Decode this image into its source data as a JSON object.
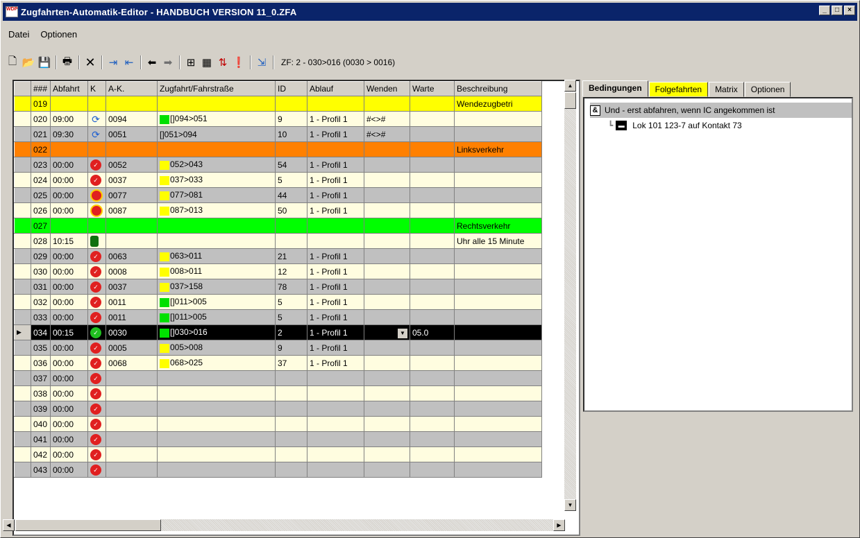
{
  "window": {
    "title": "Zugfahrten-Automatik-Editor - HANDBUCH VERSION 11_0.ZFA",
    "icon_text": "WDP"
  },
  "menu": [
    {
      "label": "Datei"
    },
    {
      "label": "Optionen"
    }
  ],
  "toolbar": {
    "status": "ZF: 2 - 030>016 (0030 > 0016)",
    "icons": [
      "new-file-icon",
      "open-folder-icon",
      "save-icon",
      "print-icon",
      "delete-icon",
      "indent-icon",
      "outdent-icon",
      "arrow-left-icon",
      "arrow-right-icon",
      "tree-icon",
      "grid-icon",
      "swap-icon",
      "warning-icon",
      "exit-icon"
    ]
  },
  "columns": [
    "###",
    "Abfahrt",
    "K",
    "A-K.",
    "Zugfahrt/Fahrstraße",
    "ID",
    "Ablauf",
    "Wenden",
    "Warte",
    "Beschreibung"
  ],
  "rows": [
    {
      "nr": "019",
      "abfahrt": "",
      "k": "",
      "ak": "",
      "zug": "",
      "id": "",
      "ablauf": "",
      "wenden": "",
      "warte": "",
      "desc": "Wendezugbetri",
      "style": "yellow",
      "kicon": "",
      "swatch": ""
    },
    {
      "nr": "020",
      "abfahrt": "09:00",
      "k": "",
      "ak": "0094",
      "zug": "[]094>051",
      "id": "9",
      "ablauf": "1 - Profil 1",
      "wenden": "#<>#",
      "warte": "",
      "desc": "",
      "style": "cream",
      "kicon": "turn",
      "swatch": "#00e000"
    },
    {
      "nr": "021",
      "abfahrt": "09:30",
      "k": "",
      "ak": "0051",
      "zug": "[]051>094",
      "id": "10",
      "ablauf": "1 - Profil 1",
      "wenden": "#<>#",
      "warte": "",
      "desc": "",
      "style": "grey",
      "kicon": "turn",
      "swatch": ""
    },
    {
      "nr": "022",
      "abfahrt": "",
      "k": "",
      "ak": "",
      "zug": "",
      "id": "",
      "ablauf": "",
      "wenden": "",
      "warte": "",
      "desc": "Linksverkehr",
      "style": "orange",
      "kicon": "",
      "swatch": ""
    },
    {
      "nr": "023",
      "abfahrt": "00:00",
      "k": "",
      "ak": "0052",
      "zug": "052>043",
      "id": "54",
      "ablauf": "1 - Profil 1",
      "wenden": "",
      "warte": "",
      "desc": "",
      "style": "grey",
      "kicon": "red",
      "swatch": "#ffff00"
    },
    {
      "nr": "024",
      "abfahrt": "00:00",
      "k": "",
      "ak": "0037",
      "zug": "037>033",
      "id": "5",
      "ablauf": "1 - Profil 1",
      "wenden": "",
      "warte": "",
      "desc": "",
      "style": "cream",
      "kicon": "red",
      "swatch": "#ffff00"
    },
    {
      "nr": "025",
      "abfahrt": "00:00",
      "k": "",
      "ak": "0077",
      "zug": "077>081",
      "id": "44",
      "ablauf": "1 - Profil 1",
      "wenden": "",
      "warte": "",
      "desc": "",
      "style": "grey",
      "kicon": "redring",
      "swatch": "#ffff00"
    },
    {
      "nr": "026",
      "abfahrt": "00:00",
      "k": "",
      "ak": "0087",
      "zug": "087>013",
      "id": "50",
      "ablauf": "1 - Profil 1",
      "wenden": "",
      "warte": "",
      "desc": "",
      "style": "cream",
      "kicon": "redring",
      "swatch": "#ffff00"
    },
    {
      "nr": "027",
      "abfahrt": "",
      "k": "",
      "ak": "",
      "zug": "",
      "id": "",
      "ablauf": "",
      "wenden": "",
      "warte": "",
      "desc": "Rechtsverkehr",
      "style": "green",
      "kicon": "",
      "swatch": ""
    },
    {
      "nr": "028",
      "abfahrt": "10:15",
      "k": "",
      "ak": "",
      "zug": "",
      "id": "",
      "ablauf": "",
      "wenden": "",
      "warte": "",
      "desc": "Uhr alle 15 Minute",
      "style": "cream",
      "kicon": "signal",
      "swatch": "",
      "plain": true
    },
    {
      "nr": "029",
      "abfahrt": "00:00",
      "k": "",
      "ak": "0063",
      "zug": "063>011",
      "id": "21",
      "ablauf": "1 - Profil 1",
      "wenden": "",
      "warte": "",
      "desc": "",
      "style": "grey",
      "kicon": "red",
      "swatch": "#ffff00"
    },
    {
      "nr": "030",
      "abfahrt": "00:00",
      "k": "",
      "ak": "0008",
      "zug": "008>011",
      "id": "12",
      "ablauf": "1 - Profil 1",
      "wenden": "",
      "warte": "",
      "desc": "",
      "style": "cream",
      "kicon": "red",
      "swatch": "#ffff00"
    },
    {
      "nr": "031",
      "abfahrt": "00:00",
      "k": "",
      "ak": "0037",
      "zug": "037>158",
      "id": "78",
      "ablauf": "1 - Profil 1",
      "wenden": "",
      "warte": "",
      "desc": "",
      "style": "grey",
      "kicon": "red",
      "swatch": "#ffff00"
    },
    {
      "nr": "032",
      "abfahrt": "00:00",
      "k": "",
      "ak": "0011",
      "zug": "[]011>005",
      "id": "5",
      "ablauf": "1 - Profil 1",
      "wenden": "",
      "warte": "",
      "desc": "",
      "style": "cream",
      "kicon": "red",
      "swatch": "#00e000"
    },
    {
      "nr": "033",
      "abfahrt": "00:00",
      "k": "",
      "ak": "0011",
      "zug": "[]011>005",
      "id": "5",
      "ablauf": "1 - Profil 1",
      "wenden": "",
      "warte": "",
      "desc": "",
      "style": "grey",
      "kicon": "red",
      "swatch": "#00e000"
    },
    {
      "nr": "034",
      "abfahrt": "00:15",
      "k": "",
      "ak": "0030",
      "zug": "[]030>016",
      "id": "2",
      "ablauf": "1 - Profil 1",
      "wenden": "",
      "warte": "05.0",
      "desc": "",
      "style": "sel",
      "kicon": "green",
      "swatch": "#00e000",
      "current": true
    },
    {
      "nr": "035",
      "abfahrt": "00:00",
      "k": "",
      "ak": "0005",
      "zug": "005>008",
      "id": "9",
      "ablauf": "1 - Profil 1",
      "wenden": "",
      "warte": "",
      "desc": "",
      "style": "grey",
      "kicon": "red",
      "swatch": "#ffff00"
    },
    {
      "nr": "036",
      "abfahrt": "00:00",
      "k": "",
      "ak": "0068",
      "zug": "068>025",
      "id": "37",
      "ablauf": "1 - Profil 1",
      "wenden": "",
      "warte": "",
      "desc": "",
      "style": "cream",
      "kicon": "red",
      "swatch": "#ffff00"
    },
    {
      "nr": "037",
      "abfahrt": "00:00",
      "k": "",
      "ak": "",
      "zug": "",
      "id": "",
      "ablauf": "",
      "wenden": "",
      "warte": "",
      "desc": "",
      "style": "grey",
      "kicon": "red",
      "swatch": ""
    },
    {
      "nr": "038",
      "abfahrt": "00:00",
      "k": "",
      "ak": "",
      "zug": "",
      "id": "",
      "ablauf": "",
      "wenden": "",
      "warte": "",
      "desc": "",
      "style": "cream",
      "kicon": "red",
      "swatch": ""
    },
    {
      "nr": "039",
      "abfahrt": "00:00",
      "k": "",
      "ak": "",
      "zug": "",
      "id": "",
      "ablauf": "",
      "wenden": "",
      "warte": "",
      "desc": "",
      "style": "grey",
      "kicon": "red",
      "swatch": ""
    },
    {
      "nr": "040",
      "abfahrt": "00:00",
      "k": "",
      "ak": "",
      "zug": "",
      "id": "",
      "ablauf": "",
      "wenden": "",
      "warte": "",
      "desc": "",
      "style": "cream",
      "kicon": "red",
      "swatch": ""
    },
    {
      "nr": "041",
      "abfahrt": "00:00",
      "k": "",
      "ak": "",
      "zug": "",
      "id": "",
      "ablauf": "",
      "wenden": "",
      "warte": "",
      "desc": "",
      "style": "grey",
      "kicon": "red",
      "swatch": ""
    },
    {
      "nr": "042",
      "abfahrt": "00:00",
      "k": "",
      "ak": "",
      "zug": "",
      "id": "",
      "ablauf": "",
      "wenden": "",
      "warte": "",
      "desc": "",
      "style": "cream",
      "kicon": "red",
      "swatch": ""
    },
    {
      "nr": "043",
      "abfahrt": "00:00",
      "k": "",
      "ak": "",
      "zug": "",
      "id": "",
      "ablauf": "",
      "wenden": "",
      "warte": "",
      "desc": "",
      "style": "grey",
      "kicon": "red",
      "swatch": ""
    }
  ],
  "tabs": [
    {
      "label": "Bedingungen",
      "active": true
    },
    {
      "label": "Folgefahrten",
      "highlight": true
    },
    {
      "label": "Matrix"
    },
    {
      "label": "Optionen"
    }
  ],
  "conditions": {
    "root_badge": "&",
    "root_label": "Und - erst abfahren, wenn IC angekommen ist",
    "child_label": "Lok 101 123-7 auf Kontakt 73"
  },
  "colors": {
    "title": "#0a246a",
    "yellow": "#ffff00",
    "orange": "#ff8000",
    "green": "#00ff00",
    "cream": "#fffde0",
    "grey": "#c0c0c0"
  }
}
